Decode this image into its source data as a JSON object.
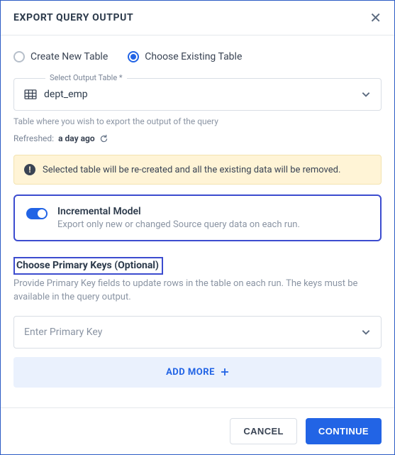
{
  "header": {
    "title": "EXPORT QUERY OUTPUT"
  },
  "mode": {
    "create_label": "Create New Table",
    "choose_label": "Choose Existing Table"
  },
  "output_table": {
    "float_label": "Select Output Table *",
    "value": "dept_emp",
    "help": "Table where you wish to export the output of the query",
    "refreshed_prefix": "Refreshed:",
    "refreshed_value": "a day ago"
  },
  "warning": {
    "text": "Selected table will be re-created and all the existing data will be removed."
  },
  "incremental": {
    "title": "Incremental Model",
    "subtitle": "Export only new or changed Source query data on each run."
  },
  "primary_keys": {
    "heading": "Choose Primary Keys (Optional)",
    "subtitle": "Provide Primary Key fields to update rows in the table on each run. The keys must be available in the query output.",
    "placeholder": "Enter Primary Key",
    "add_more_label": "ADD MORE"
  },
  "footer": {
    "cancel": "CANCEL",
    "continue": "CONTINUE"
  }
}
